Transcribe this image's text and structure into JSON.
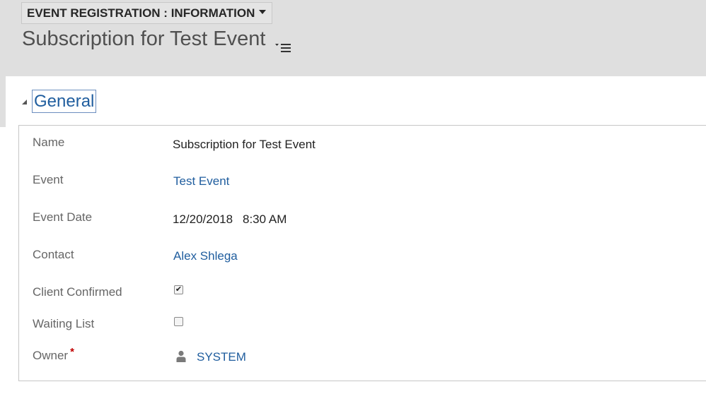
{
  "header": {
    "form_selector_label": "EVENT REGISTRATION : INFORMATION",
    "record_title": "Subscription for Test Event"
  },
  "section": {
    "title": "General",
    "fields": {
      "name": {
        "label": "Name",
        "value": "Subscription for Test Event"
      },
      "event": {
        "label": "Event",
        "value": "Test Event"
      },
      "event_date": {
        "label": "Event Date",
        "date": "12/20/2018",
        "time": "8:30 AM"
      },
      "contact": {
        "label": "Contact",
        "value": "Alex Shlega"
      },
      "client_confirmed": {
        "label": "Client Confirmed",
        "checked": true
      },
      "waiting_list": {
        "label": "Waiting List",
        "checked": false
      },
      "owner": {
        "label": "Owner",
        "required_mark": "*",
        "value": "SYSTEM"
      }
    }
  },
  "icons": {
    "form_selector": "chevron-down-icon",
    "record_nav": "nav-menu-icon",
    "section_toggle": "collapse-triangle-icon",
    "owner": "user-icon"
  },
  "colors": {
    "link": "#1f5d9e",
    "header_bg": "#dfdfdf",
    "required": "#c00000"
  }
}
